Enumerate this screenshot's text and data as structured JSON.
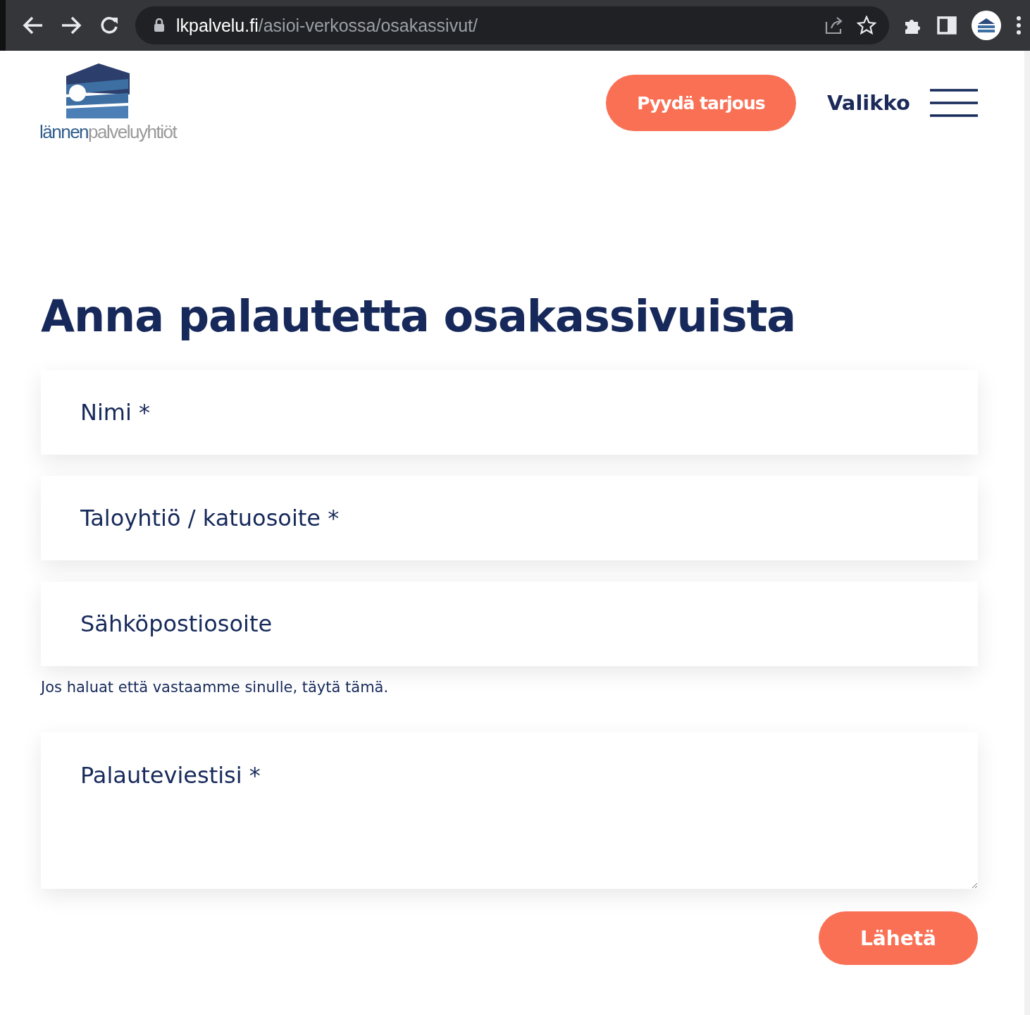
{
  "browser": {
    "url_domain": "lkpalvelu.fi",
    "url_path": "/asioi-verkossa/osakassivut/"
  },
  "header": {
    "logo": {
      "part_1": "lännen",
      "part_2": "palveluyhtiöt"
    },
    "cta": "Pyydä tarjous",
    "menu": "Valikko"
  },
  "heading": "Anna palautetta osakassivuista",
  "fields": [
    {
      "kind": "input",
      "placeholder": "Nimi *"
    },
    {
      "kind": "input",
      "placeholder": "Taloyhtiö / katuosoite *"
    },
    {
      "kind": "input",
      "placeholder": "Sähköpostiosoite",
      "help": "Jos haluat että vastaamme sinulle, täytä tämä."
    },
    {
      "kind": "textarea",
      "placeholder": "Palauteviestisi *"
    }
  ],
  "submit": "Lähetä"
}
